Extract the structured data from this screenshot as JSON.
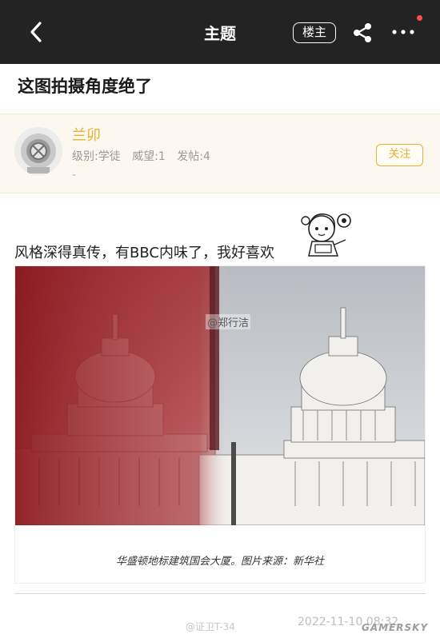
{
  "topbar": {
    "title": "主题",
    "author_only_label": "楼主"
  },
  "post": {
    "title": "这图拍摄角度绝了",
    "body": "风格深得真传，有BBC内味了，我好喜欢",
    "image_watermark": "@郑行洁",
    "image_caption": "华盛顿地标建筑国会大厦。图片来源：新华社",
    "footer_weibo": "@证卫T-34",
    "timestamp": "2022-11-10 08:32",
    "site_watermark": "GAMERSKY"
  },
  "user": {
    "name": "兰卯",
    "level": "级别:学徒",
    "prestige": "威望:1",
    "posts": "发帖:4",
    "signature": "-",
    "follow_label": "关注"
  },
  "colors": {
    "topbar_bg": "#232323",
    "accent": "#e5b22f",
    "user_bar_bg": "#fcf8ef",
    "notification_dot": "#ff4d4d"
  },
  "icons": {
    "back": "chevron-left-icon",
    "share": "share-icon",
    "more": "more-dots-icon",
    "avatar": "diving-helmet-avatar-icon"
  }
}
